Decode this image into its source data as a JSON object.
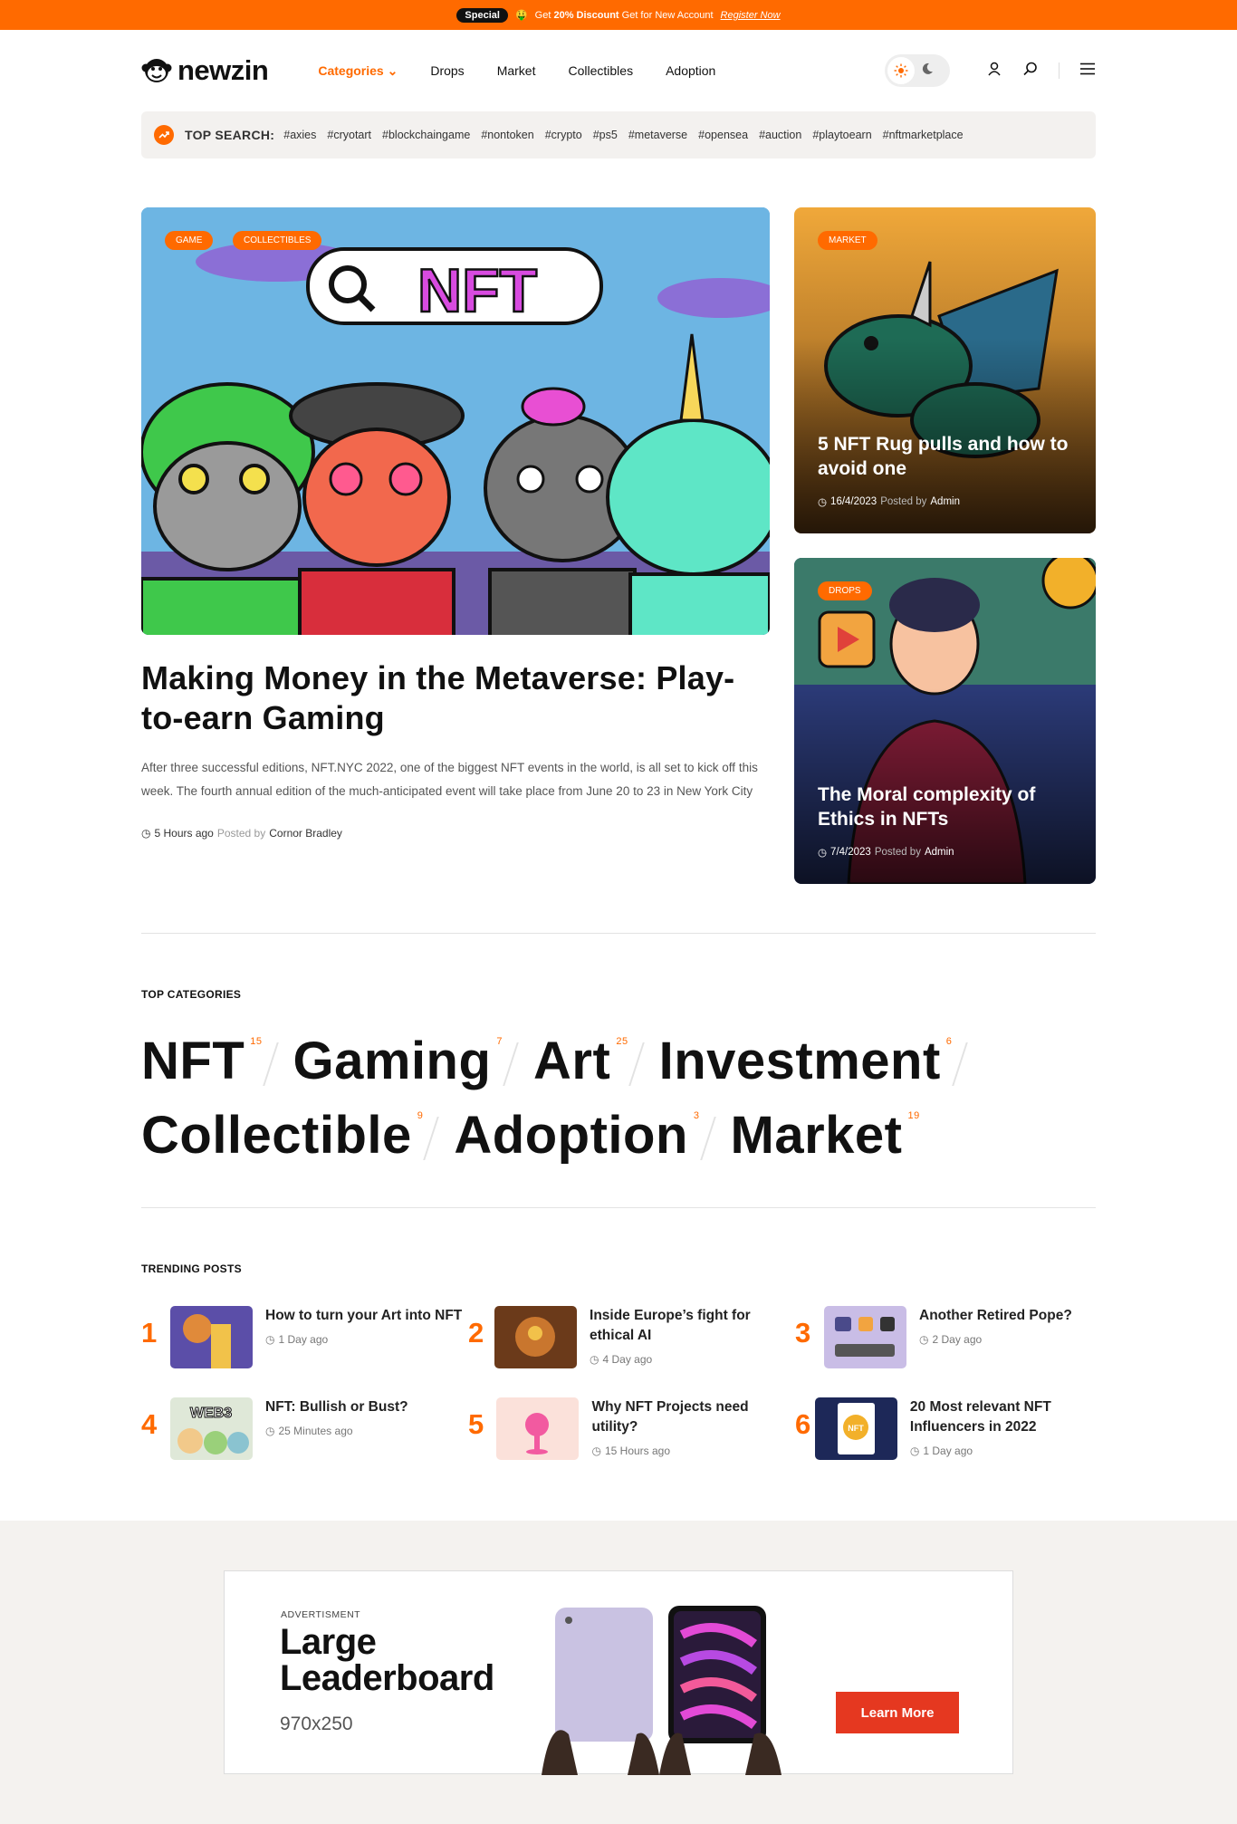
{
  "promo": {
    "pill": "Special",
    "emoji": "🤑",
    "prefix": "Get ",
    "bold": "20% Discount",
    "suffix": " Get for New Account",
    "link": "Register Now"
  },
  "header": {
    "logo": "newzin",
    "nav": [
      "Categories",
      "Drops",
      "Market",
      "Collectibles",
      "Adoption"
    ],
    "icons": [
      "sun-icon",
      "moon-icon",
      "user-icon",
      "search-icon",
      "menu-icon"
    ]
  },
  "top_search": {
    "label": "TOP SEARCH:",
    "tags": [
      "#axies",
      "#cryotart",
      "#blockchaingame",
      "#nontoken",
      "#crypto",
      "#ps5",
      "#metaverse",
      "#opensea",
      "#auction",
      "#playtoearn",
      "#nftmarketplace"
    ]
  },
  "hero": {
    "badges": [
      "GAME",
      "COLLECTIBLES"
    ],
    "image_text": "NFT",
    "title": "Making Money in the Metaverse: Play-to-earn Gaming",
    "desc": "After three successful editions, NFT.NYC 2022, one of the biggest NFT events in the world, is all set to kick off this week. The fourth annual edition of the much-anticipated event will take place from June 20 to 23 in New York City",
    "time": "5 Hours ago",
    "posted_by": "Posted by",
    "author": "Cornor Bradley"
  },
  "side_cards": [
    {
      "badge": "MARKET",
      "title": "5 NFT Rug pulls and how to avoid one",
      "date": "16/4/2023",
      "posted_by": "Posted by",
      "author": "Admin"
    },
    {
      "badge": "DROPS",
      "title": "The Moral complexity of Ethics in NFTs",
      "date": "7/4/2023",
      "posted_by": "Posted by",
      "author": "Admin"
    }
  ],
  "categories": {
    "label": "TOP CATEGORIES",
    "items": [
      {
        "name": "NFT",
        "count": "15"
      },
      {
        "name": "Gaming",
        "count": "7"
      },
      {
        "name": "Art",
        "count": "25"
      },
      {
        "name": "Investment",
        "count": "6"
      },
      {
        "name": "Collectible",
        "count": "9"
      },
      {
        "name": "Adoption",
        "count": "3"
      },
      {
        "name": "Market",
        "count": "19"
      }
    ]
  },
  "trending": {
    "label": "TRENDING POSTS",
    "items": [
      {
        "num": "1",
        "title": "How to turn your Art into NFT",
        "time": "1 Day ago"
      },
      {
        "num": "2",
        "title": "Inside Europe’s fight for ethical AI",
        "time": "4 Day ago"
      },
      {
        "num": "3",
        "title": "Another Retired Pope?",
        "time": "2 Day ago"
      },
      {
        "num": "4",
        "title": "NFT: Bullish or Bust?",
        "time": "25 Minutes ago"
      },
      {
        "num": "5",
        "title": "Why NFT Projects need utility?",
        "time": "15 Hours ago"
      },
      {
        "num": "6",
        "title": "20 Most relevant NFT Influencers in 2022",
        "time": "1 Day ago"
      }
    ],
    "thumb_text": {
      "web3": "WEB3",
      "nft": "NFT"
    }
  },
  "ad": {
    "label": "ADVERTISMENT",
    "line1": "Large",
    "line2": "Leaderboard",
    "size": "970x250",
    "button": "Learn More"
  },
  "colors": {
    "accent": "#ff6a00",
    "ad_button": "#e53820",
    "ad_band": "#f4f2ef"
  }
}
